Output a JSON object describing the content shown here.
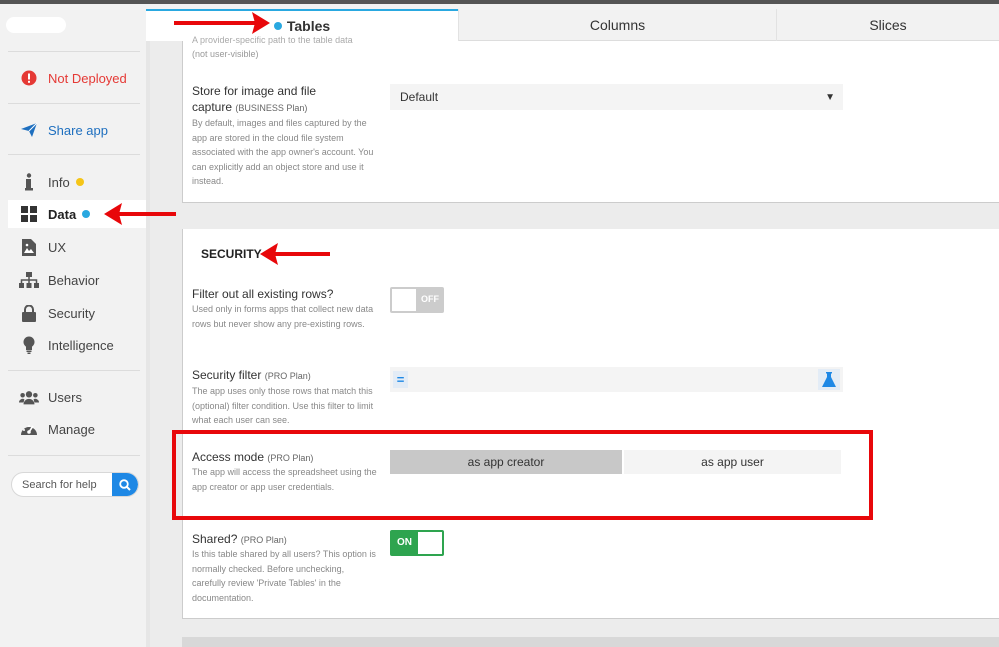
{
  "sidebar": {
    "status": {
      "label": "Not Deployed",
      "color": "#e53935"
    },
    "share": {
      "label": "Share app"
    },
    "items": [
      {
        "label": "Info",
        "icon": "info-icon",
        "dot": "#f5c518"
      },
      {
        "label": "Data",
        "icon": "grid-icon",
        "dot": "#29a8e0",
        "active": true
      },
      {
        "label": "UX",
        "icon": "image-file-icon"
      },
      {
        "label": "Behavior",
        "icon": "sitemap-icon"
      },
      {
        "label": "Security",
        "icon": "lock-icon"
      },
      {
        "label": "Intelligence",
        "icon": "lightbulb-icon"
      }
    ],
    "users": {
      "label": "Users",
      "icon": "users-icon"
    },
    "manage": {
      "label": "Manage",
      "icon": "dashboard-icon"
    },
    "search": {
      "placeholder": "Search for help",
      "icon": "search-icon"
    }
  },
  "tabs": [
    {
      "label": "Tables",
      "active": true,
      "dot": "#29a8e0"
    },
    {
      "label": "Columns"
    },
    {
      "label": "Slices"
    }
  ],
  "storage": {
    "top_desc_1": "A provider-specific path to the table data",
    "top_desc_2": "(not user-visible)",
    "label_1": "Store for image and file",
    "label_2": "capture",
    "plan": "(BUSINESS Plan)",
    "desc": "By default, images and files captured by the app are stored in the cloud file system associated with the app owner's account. You can explicitly add an object store and use it instead.",
    "value": "Default"
  },
  "security": {
    "heading": "SECURITY",
    "filter_rows": {
      "label": "Filter out all existing rows?",
      "desc": "Used only in forms apps that collect new data rows but never show any pre-existing rows.",
      "toggle": "OFF"
    },
    "security_filter": {
      "label": "Security filter",
      "plan": "(PRO Plan)",
      "desc": "The app uses only those rows that match this (optional) filter condition. Use this filter to limit what each user can see.",
      "eq": "=",
      "value": ""
    },
    "access_mode": {
      "label": "Access mode",
      "plan": "(PRO Plan)",
      "desc": "The app will access the spreadsheet using the app creator or app user credentials.",
      "options": [
        "as app creator",
        "as app user"
      ],
      "selected": "as app creator"
    },
    "shared": {
      "label": "Shared?",
      "plan": "(PRO Plan)",
      "desc": "Is this table shared by all users? This option is normally checked. Before unchecking, carefully review 'Private Tables' in the documentation.",
      "toggle": "ON"
    }
  },
  "annotation_color": "#e8070a"
}
